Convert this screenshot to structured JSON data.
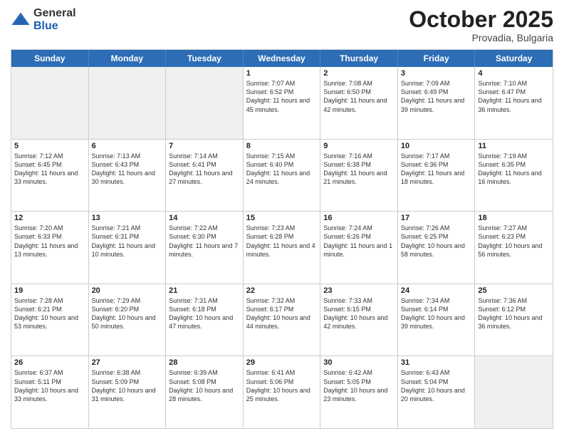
{
  "logo": {
    "general": "General",
    "blue": "Blue"
  },
  "title": "October 2025",
  "location": "Provadia, Bulgaria",
  "days": [
    "Sunday",
    "Monday",
    "Tuesday",
    "Wednesday",
    "Thursday",
    "Friday",
    "Saturday"
  ],
  "rows": [
    [
      {
        "day": "",
        "text": ""
      },
      {
        "day": "",
        "text": ""
      },
      {
        "day": "",
        "text": ""
      },
      {
        "day": "1",
        "text": "Sunrise: 7:07 AM\nSunset: 6:52 PM\nDaylight: 11 hours and 45 minutes."
      },
      {
        "day": "2",
        "text": "Sunrise: 7:08 AM\nSunset: 6:50 PM\nDaylight: 11 hours and 42 minutes."
      },
      {
        "day": "3",
        "text": "Sunrise: 7:09 AM\nSunset: 6:49 PM\nDaylight: 11 hours and 39 minutes."
      },
      {
        "day": "4",
        "text": "Sunrise: 7:10 AM\nSunset: 6:47 PM\nDaylight: 11 hours and 36 minutes."
      }
    ],
    [
      {
        "day": "5",
        "text": "Sunrise: 7:12 AM\nSunset: 6:45 PM\nDaylight: 11 hours and 33 minutes."
      },
      {
        "day": "6",
        "text": "Sunrise: 7:13 AM\nSunset: 6:43 PM\nDaylight: 11 hours and 30 minutes."
      },
      {
        "day": "7",
        "text": "Sunrise: 7:14 AM\nSunset: 6:41 PM\nDaylight: 11 hours and 27 minutes."
      },
      {
        "day": "8",
        "text": "Sunrise: 7:15 AM\nSunset: 6:40 PM\nDaylight: 11 hours and 24 minutes."
      },
      {
        "day": "9",
        "text": "Sunrise: 7:16 AM\nSunset: 6:38 PM\nDaylight: 11 hours and 21 minutes."
      },
      {
        "day": "10",
        "text": "Sunrise: 7:17 AM\nSunset: 6:36 PM\nDaylight: 11 hours and 18 minutes."
      },
      {
        "day": "11",
        "text": "Sunrise: 7:19 AM\nSunset: 6:35 PM\nDaylight: 11 hours and 16 minutes."
      }
    ],
    [
      {
        "day": "12",
        "text": "Sunrise: 7:20 AM\nSunset: 6:33 PM\nDaylight: 11 hours and 13 minutes."
      },
      {
        "day": "13",
        "text": "Sunrise: 7:21 AM\nSunset: 6:31 PM\nDaylight: 11 hours and 10 minutes."
      },
      {
        "day": "14",
        "text": "Sunrise: 7:22 AM\nSunset: 6:30 PM\nDaylight: 11 hours and 7 minutes."
      },
      {
        "day": "15",
        "text": "Sunrise: 7:23 AM\nSunset: 6:28 PM\nDaylight: 11 hours and 4 minutes."
      },
      {
        "day": "16",
        "text": "Sunrise: 7:24 AM\nSunset: 6:26 PM\nDaylight: 11 hours and 1 minute."
      },
      {
        "day": "17",
        "text": "Sunrise: 7:26 AM\nSunset: 6:25 PM\nDaylight: 10 hours and 58 minutes."
      },
      {
        "day": "18",
        "text": "Sunrise: 7:27 AM\nSunset: 6:23 PM\nDaylight: 10 hours and 56 minutes."
      }
    ],
    [
      {
        "day": "19",
        "text": "Sunrise: 7:28 AM\nSunset: 6:21 PM\nDaylight: 10 hours and 53 minutes."
      },
      {
        "day": "20",
        "text": "Sunrise: 7:29 AM\nSunset: 6:20 PM\nDaylight: 10 hours and 50 minutes."
      },
      {
        "day": "21",
        "text": "Sunrise: 7:31 AM\nSunset: 6:18 PM\nDaylight: 10 hours and 47 minutes."
      },
      {
        "day": "22",
        "text": "Sunrise: 7:32 AM\nSunset: 6:17 PM\nDaylight: 10 hours and 44 minutes."
      },
      {
        "day": "23",
        "text": "Sunrise: 7:33 AM\nSunset: 6:15 PM\nDaylight: 10 hours and 42 minutes."
      },
      {
        "day": "24",
        "text": "Sunrise: 7:34 AM\nSunset: 6:14 PM\nDaylight: 10 hours and 39 minutes."
      },
      {
        "day": "25",
        "text": "Sunrise: 7:36 AM\nSunset: 6:12 PM\nDaylight: 10 hours and 36 minutes."
      }
    ],
    [
      {
        "day": "26",
        "text": "Sunrise: 6:37 AM\nSunset: 5:11 PM\nDaylight: 10 hours and 33 minutes."
      },
      {
        "day": "27",
        "text": "Sunrise: 6:38 AM\nSunset: 5:09 PM\nDaylight: 10 hours and 31 minutes."
      },
      {
        "day": "28",
        "text": "Sunrise: 6:39 AM\nSunset: 5:08 PM\nDaylight: 10 hours and 28 minutes."
      },
      {
        "day": "29",
        "text": "Sunrise: 6:41 AM\nSunset: 5:06 PM\nDaylight: 10 hours and 25 minutes."
      },
      {
        "day": "30",
        "text": "Sunrise: 6:42 AM\nSunset: 5:05 PM\nDaylight: 10 hours and 23 minutes."
      },
      {
        "day": "31",
        "text": "Sunrise: 6:43 AM\nSunset: 5:04 PM\nDaylight: 10 hours and 20 minutes."
      },
      {
        "day": "",
        "text": ""
      }
    ]
  ]
}
